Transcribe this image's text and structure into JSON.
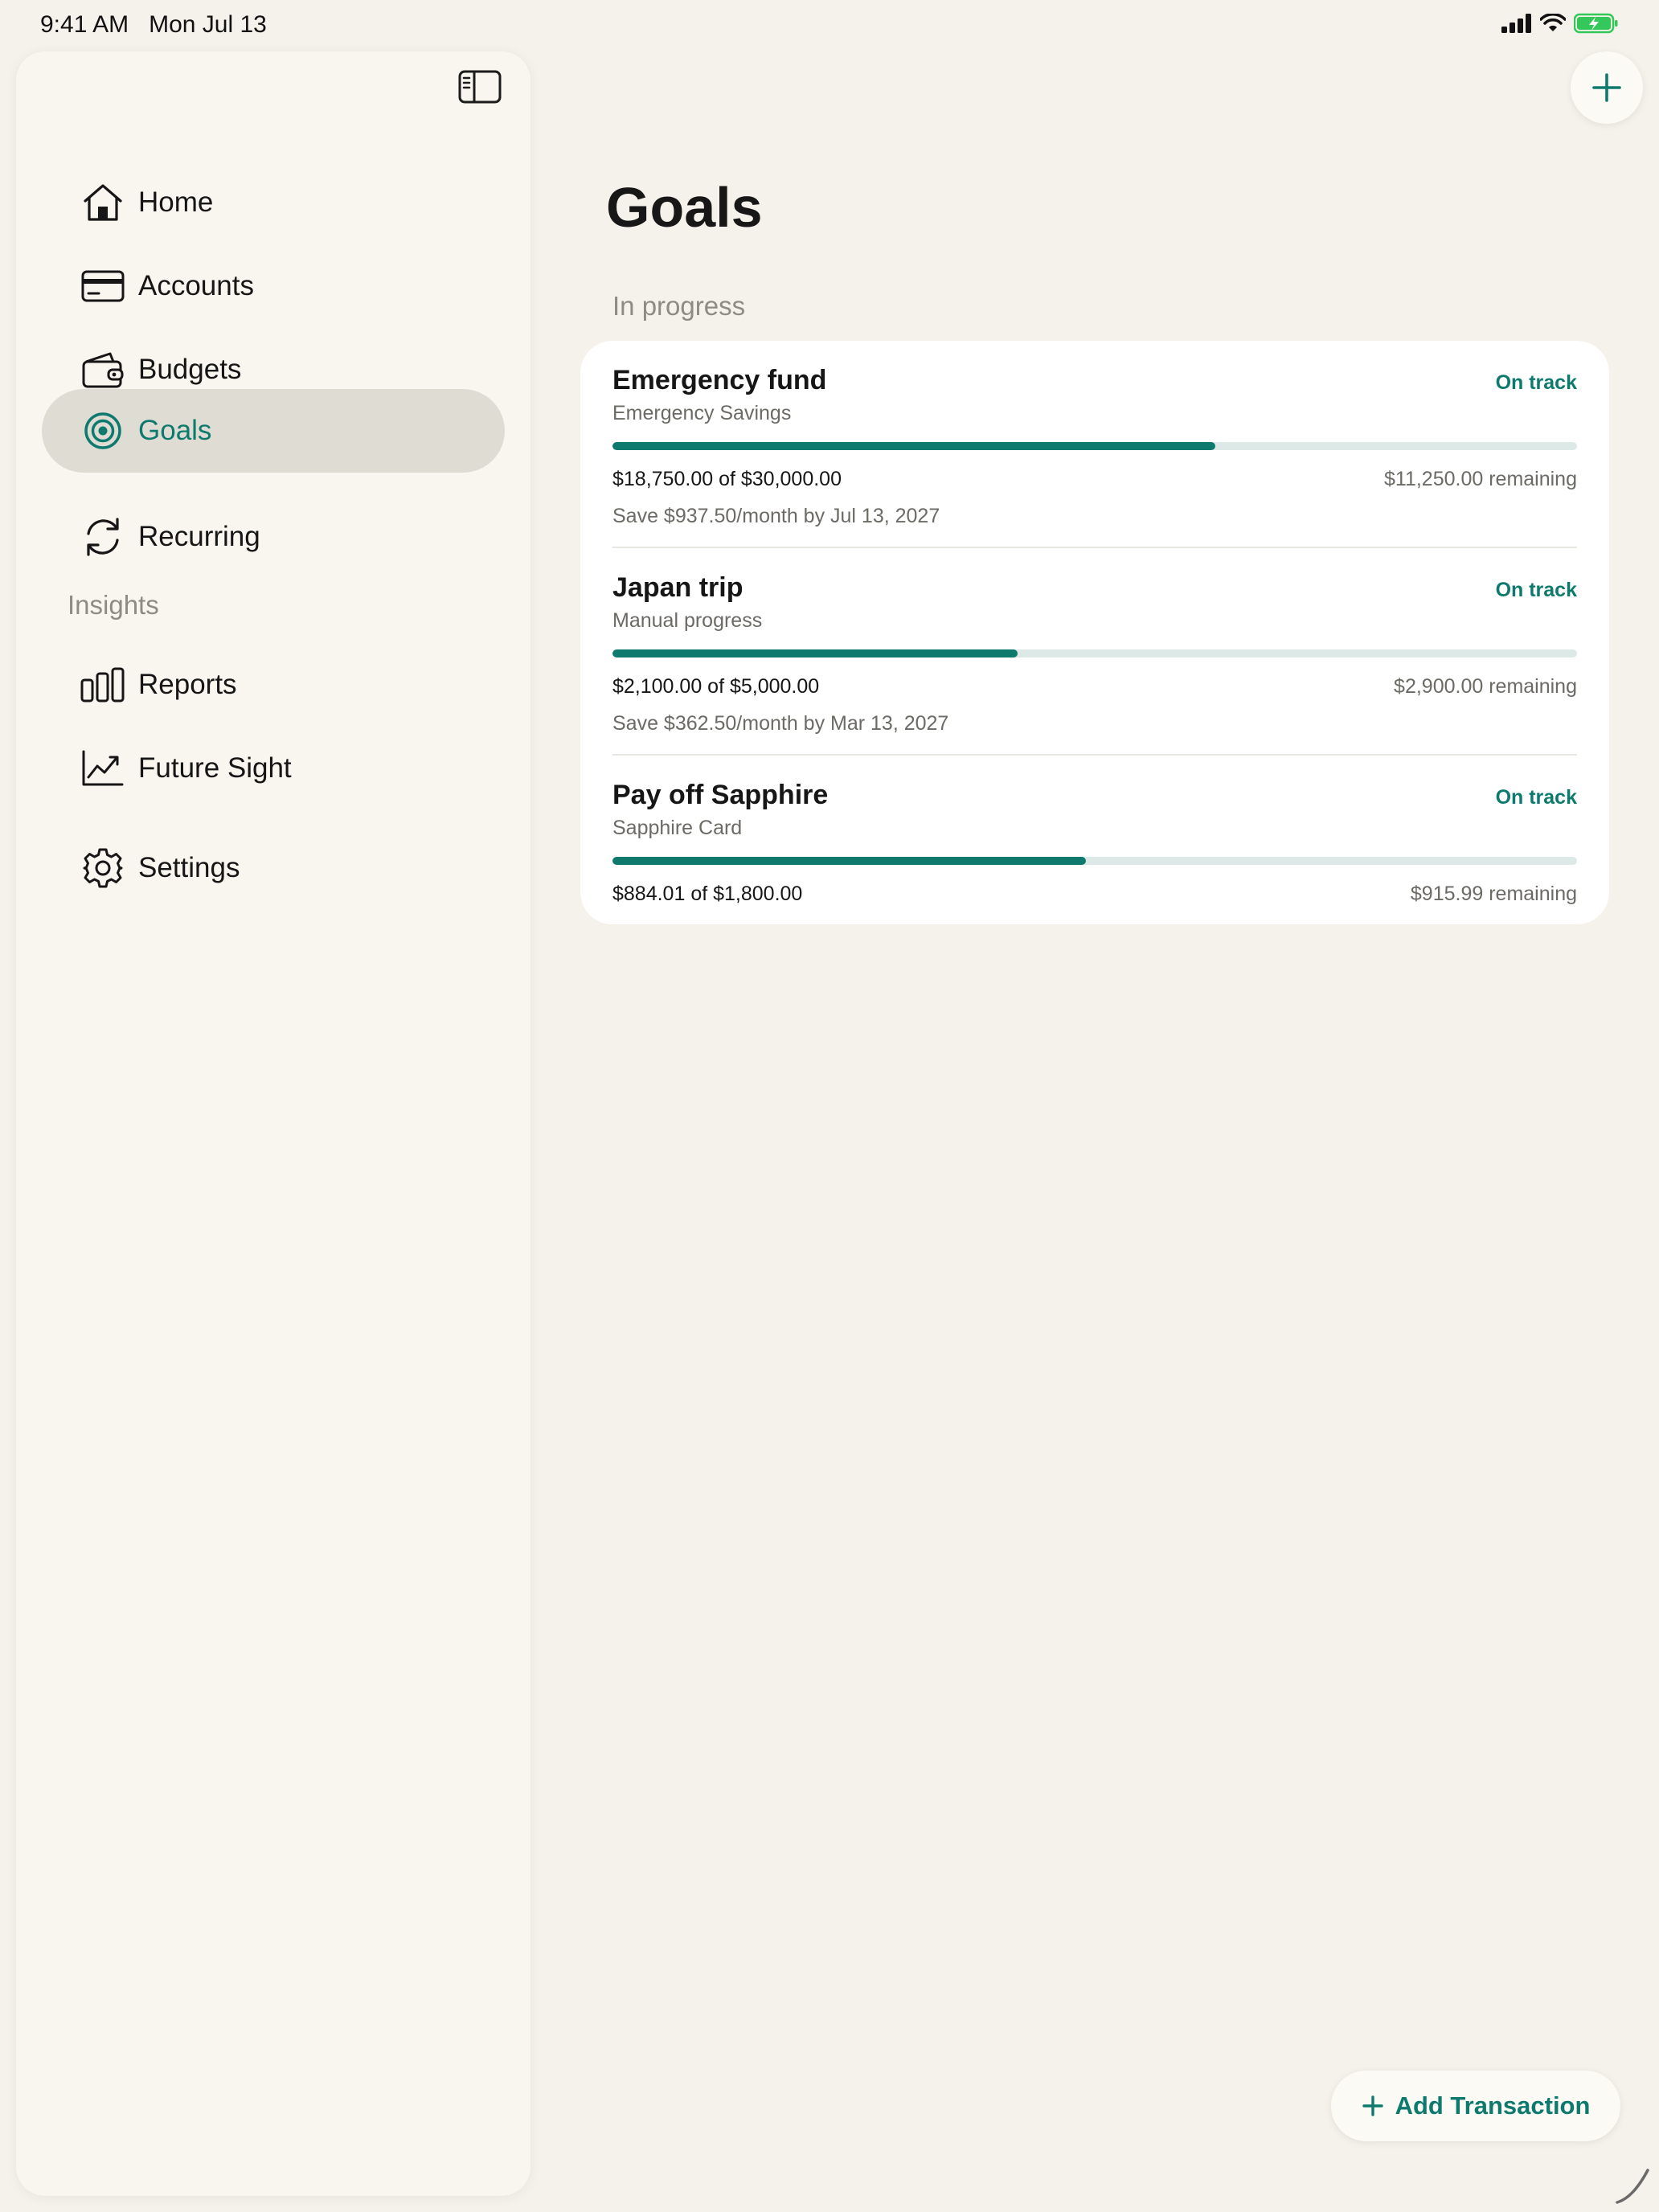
{
  "status_bar": {
    "time": "9:41 AM",
    "date": "Mon Jul 13"
  },
  "sidebar": {
    "items": [
      {
        "label": "Home",
        "icon": "home-icon"
      },
      {
        "label": "Accounts",
        "icon": "card-icon"
      },
      {
        "label": "Budgets",
        "icon": "wallet-icon"
      },
      {
        "label": "Goals",
        "icon": "target-icon",
        "active": true
      },
      {
        "label": "Recurring",
        "icon": "recurring-icon"
      }
    ],
    "insights_label": "Insights",
    "insights_items": [
      {
        "label": "Reports",
        "icon": "bar-chart-icon"
      },
      {
        "label": "Future Sight",
        "icon": "trend-chart-icon"
      }
    ],
    "settings": {
      "label": "Settings",
      "icon": "gear-icon"
    }
  },
  "main": {
    "title": "Goals",
    "group_label": "In progress",
    "goals": [
      {
        "name": "Emergency fund",
        "subtitle": "Emergency Savings",
        "status": "On track",
        "progress": 0.625,
        "amount": "$18,750.00 of $30,000.00",
        "remaining": "$11,250.00 remaining",
        "plan": "Save $937.50/month by Jul 13, 2027"
      },
      {
        "name": "Japan trip",
        "subtitle": "Manual progress",
        "status": "On track",
        "progress": 0.42,
        "amount": "$2,100.00 of $5,000.00",
        "remaining": "$2,900.00 remaining",
        "plan": "Save $362.50/month by Mar 13, 2027"
      },
      {
        "name": "Pay off Sapphire",
        "subtitle": "Sapphire Card",
        "status": "On track",
        "progress": 0.4911,
        "amount": "$884.01 of $1,800.00",
        "remaining": "$915.99 remaining",
        "plan": ""
      }
    ],
    "add_transaction_label": "Add Transaction"
  },
  "colors": {
    "accent": "#0e7a6e",
    "background": "#f5f2eb",
    "sidebar": "#f8f6ee",
    "active_item": "#dfdcd4",
    "track": "#dde9e6"
  }
}
